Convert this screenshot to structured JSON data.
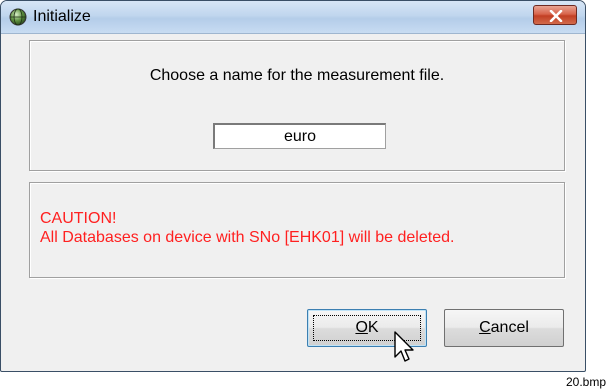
{
  "window": {
    "title": "Initialize",
    "icon": "app-globe-icon",
    "close_icon": "close-x-icon"
  },
  "name_group": {
    "prompt": "Choose a name for the measurement file.",
    "input_value": "euro"
  },
  "caution_group": {
    "heading": "CAUTION!",
    "message": "All Databases on device with SNo [EHK01] will be deleted.",
    "color": "#ff2020"
  },
  "buttons": {
    "ok": {
      "mnemonic": "O",
      "rest": "K"
    },
    "cancel": {
      "mnemonic": "C",
      "rest": "ancel"
    }
  },
  "footnote": "20.bmp"
}
